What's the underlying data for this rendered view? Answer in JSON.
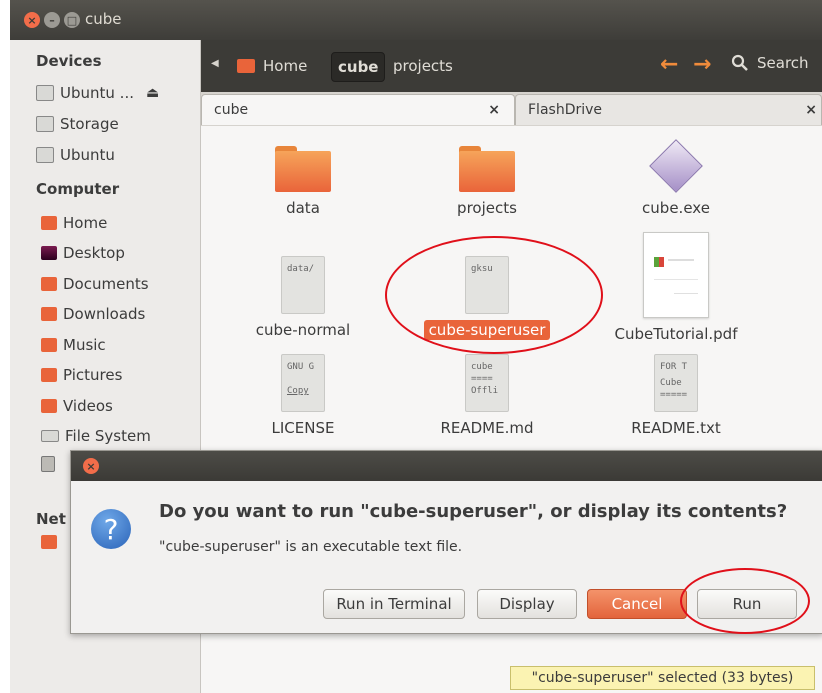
{
  "window": {
    "title": "cube"
  },
  "sidebar": {
    "devices_label": "Devices",
    "devices": [
      "Ubuntu ...",
      "Storage",
      "Ubuntu"
    ],
    "computer_label": "Computer",
    "computer": [
      "Home",
      "Desktop",
      "Documents",
      "Downloads",
      "Music",
      "Pictures",
      "Videos",
      "File System"
    ],
    "network_label": "Net"
  },
  "toolbar": {
    "breadcrumbs": [
      "Home",
      "cube",
      "projects"
    ],
    "search_label": "Search"
  },
  "tabs": [
    {
      "label": "cube",
      "close": "×"
    },
    {
      "label": "FlashDrive",
      "close": "×"
    }
  ],
  "files": {
    "data": "data",
    "projects": "projects",
    "cube_exe": "cube.exe",
    "cube_normal": {
      "name": "cube-normal",
      "preview": "data/"
    },
    "cube_superuser": {
      "name": "cube-superuser",
      "preview": "gksu"
    },
    "cube_tutorial": "CubeTutorial.pdf",
    "license": {
      "name": "LICENSE",
      "preview": [
        "GNU G",
        "",
        "Copy"
      ]
    },
    "readme_md": {
      "name": "README.md",
      "preview": [
        "cube",
        "====",
        "Offli"
      ]
    },
    "readme_txt": {
      "name": "README.txt",
      "preview": [
        "FOR T",
        "",
        "Cube",
        "====="
      ]
    }
  },
  "dialog": {
    "question": "Do you want to run \"cube-superuser\", or display its contents?",
    "detail": "\"cube-superuser\" is an executable text file.",
    "buttons": {
      "run_in_terminal": "Run in Terminal",
      "display": "Display",
      "cancel": "Cancel",
      "run": "Run"
    }
  },
  "status": "\"cube-superuser\" selected (33 bytes)",
  "colors": {
    "accent": "#e9643a",
    "annotation": "#e0101a",
    "folder": "#f08b3b"
  }
}
